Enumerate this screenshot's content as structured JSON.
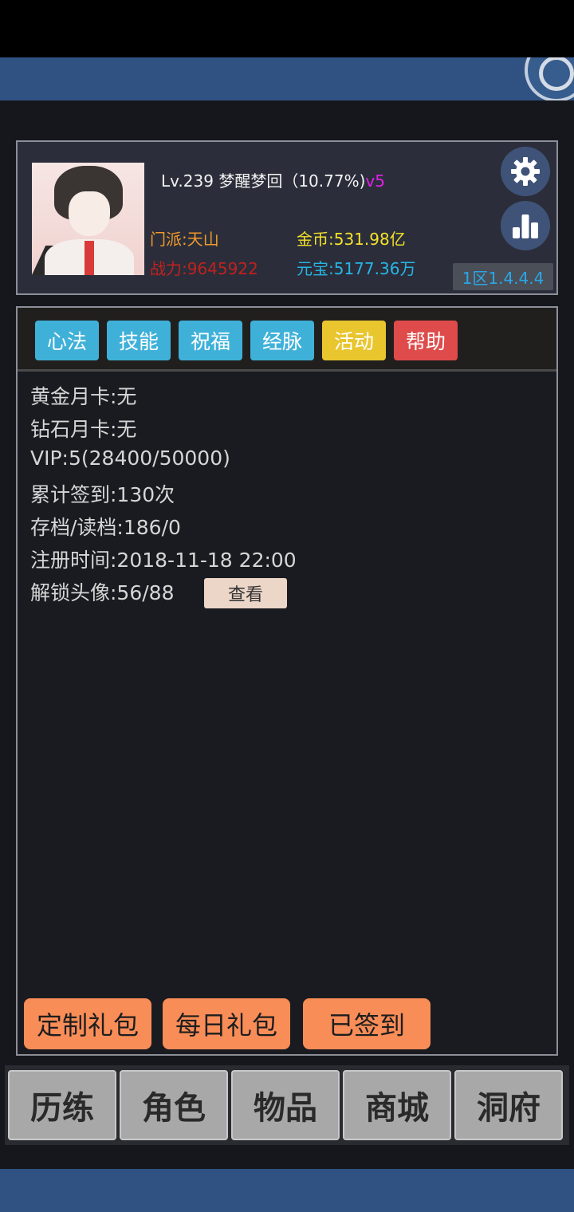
{
  "colors": {
    "top_band": "#2f5282",
    "tab_blue": "#3fb1d9",
    "tab_yellow": "#e9c52e",
    "tab_red": "#df4b4b",
    "action_orange": "#f88d58",
    "sect_orange": "#f09a2a",
    "power_red": "#c0211f",
    "gold_yellow": "#f4e12b",
    "ingot_blue": "#27b6e6",
    "vip_magenta": "#e01fe8"
  },
  "profile": {
    "level_name": "Lv.239 梦醒梦回（10.77%)",
    "vip": "v5",
    "sect": "门派:天山",
    "power": "战力:9645922",
    "gold": "金币:531.98亿",
    "ingot": "元宝:5177.36万",
    "server": "1区1.4.4.4",
    "settings_icon": "gear-icon",
    "stats_icon": "bar-chart-icon"
  },
  "tabs": [
    {
      "label": "心法"
    },
    {
      "label": "技能"
    },
    {
      "label": "祝福"
    },
    {
      "label": "经脉"
    },
    {
      "label": "活动"
    },
    {
      "label": "帮助"
    }
  ],
  "info": {
    "gold_card": "黄金月卡:无",
    "diamond_card": "钻石月卡:无",
    "vip": "VIP:5(28400/50000)",
    "checkin_total": "累计签到:130次",
    "save_load": "存档/读档:186/0",
    "register_time": "注册时间:2018-11-18 22:00",
    "avatars_unlocked": "解锁头像:56/88",
    "view_button": "查看"
  },
  "actions": {
    "custom_pack": "定制礼包",
    "daily_pack": "每日礼包",
    "signed_in": "已签到"
  },
  "nav": [
    "历练",
    "角色",
    "物品",
    "商城",
    "洞府"
  ]
}
